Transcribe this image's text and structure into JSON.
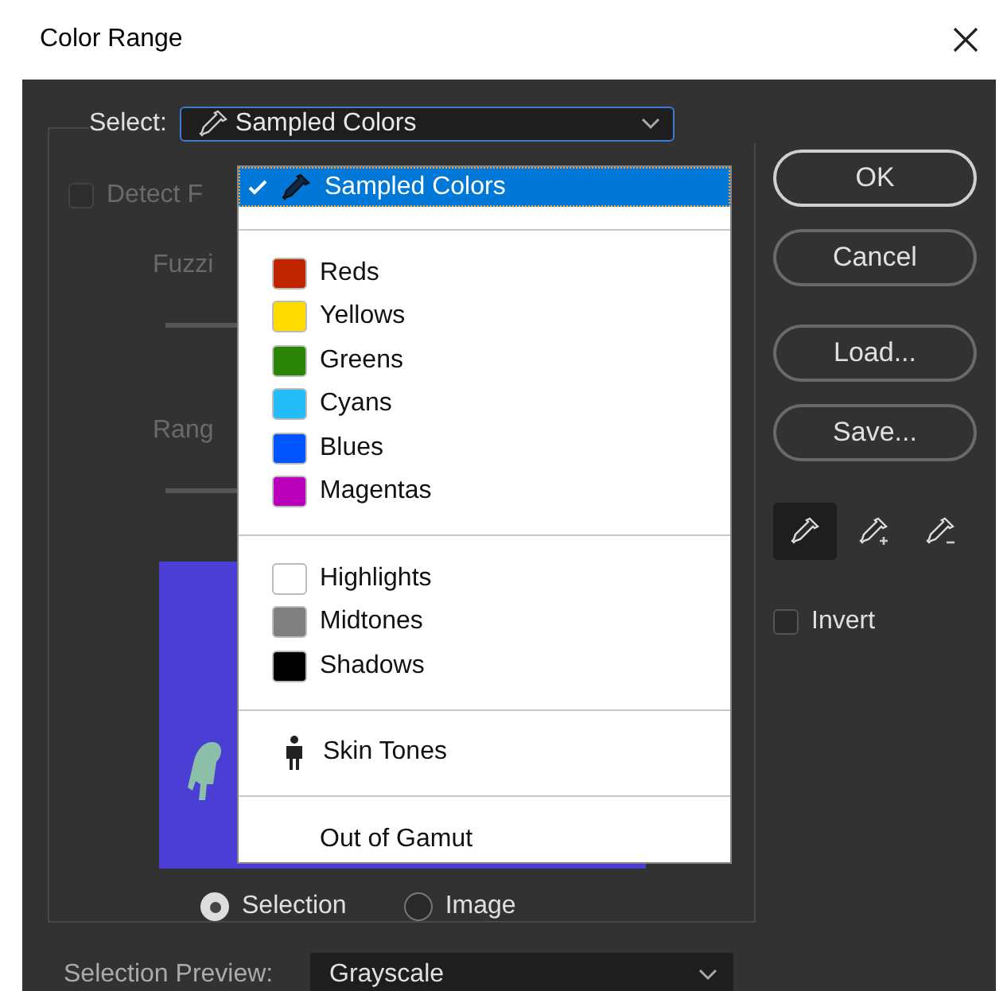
{
  "window": {
    "title": "Color Range"
  },
  "select": {
    "label": "Select:",
    "value": "Sampled Colors"
  },
  "menu": {
    "items": [
      {
        "kind": "sampled",
        "label": "Sampled Colors",
        "selected": true
      },
      {
        "kind": "separator"
      },
      {
        "kind": "swatch",
        "label": "Reds",
        "color": "#bf2600",
        "selected": false
      },
      {
        "kind": "swatch",
        "label": "Yellows",
        "color": "#ffdc00",
        "selected": false
      },
      {
        "kind": "swatch",
        "label": "Greens",
        "color": "#2a8506",
        "selected": false
      },
      {
        "kind": "swatch",
        "label": "Cyans",
        "color": "#22bdf8",
        "selected": false
      },
      {
        "kind": "swatch",
        "label": "Blues",
        "color": "#0055ff",
        "selected": false
      },
      {
        "kind": "swatch",
        "label": "Magentas",
        "color": "#bb00bb",
        "selected": false
      },
      {
        "kind": "separator"
      },
      {
        "kind": "swatch",
        "label": "Highlights",
        "color": "#ffffff",
        "selected": false
      },
      {
        "kind": "swatch",
        "label": "Midtones",
        "color": "#808080",
        "selected": false
      },
      {
        "kind": "swatch",
        "label": "Shadows",
        "color": "#000000",
        "selected": false
      },
      {
        "kind": "separator"
      },
      {
        "kind": "skin",
        "label": "Skin Tones",
        "selected": false
      },
      {
        "kind": "separator"
      },
      {
        "kind": "plain",
        "label": "Out of Gamut",
        "selected": false
      }
    ]
  },
  "detect": {
    "label": "Detect F",
    "checked": false,
    "disabled": true
  },
  "fuzziness": {
    "label": "Fuzzi"
  },
  "range": {
    "label": "Rang"
  },
  "view_options": [
    {
      "label": "Selection",
      "selected": true
    },
    {
      "label": "Image",
      "selected": false
    }
  ],
  "selection_preview": {
    "label": "Selection Preview:",
    "value": "Grayscale"
  },
  "buttons": [
    {
      "label": "OK",
      "default": true
    },
    {
      "label": "Cancel",
      "default": false
    },
    {
      "label": "Load...",
      "default": false
    },
    {
      "label": "Save...",
      "default": false
    }
  ],
  "eyedroppers": [
    {
      "kind": "sample",
      "selected": true
    },
    {
      "kind": "add",
      "selected": false
    },
    {
      "kind": "subtract",
      "selected": false
    }
  ],
  "invert": {
    "label": "Invert",
    "checked": false
  }
}
